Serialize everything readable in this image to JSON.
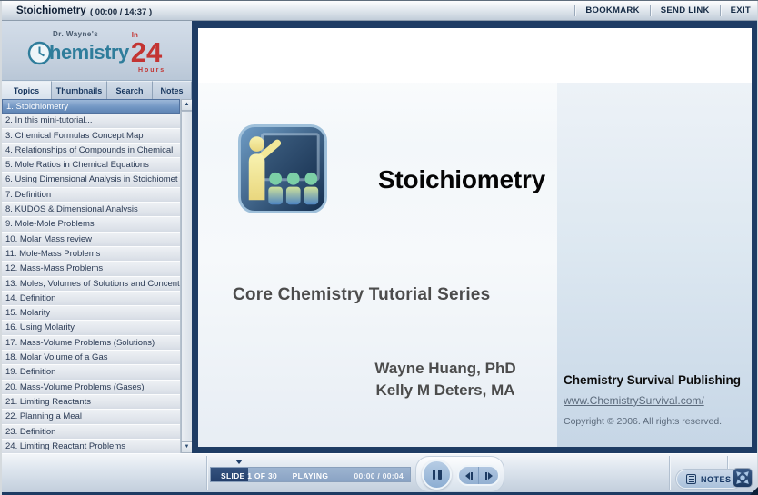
{
  "header": {
    "title": "Stoichiometry",
    "time": "( 00:00 / 14:37 )",
    "menu": [
      "BOOKMARK",
      "SEND LINK",
      "EXIT"
    ]
  },
  "logo": {
    "pre": "Dr. Wayne's",
    "word": "hemistry",
    "in": "In",
    "number": "24",
    "hours": "Hours"
  },
  "sidebar": {
    "tabs": [
      "Topics",
      "Thumbnails",
      "Search",
      "Notes"
    ],
    "active_tab": "Topics",
    "topics": [
      "1. Stoichiometry",
      "2. In this mini-tutorial...",
      "3. Chemical Formulas Concept Map",
      "4. Relationships of Compounds in Chemical",
      "5. Mole Ratios in Chemical Equations",
      "6. Using Dimensional Analysis in Stoichiomet",
      "7. Definition",
      "8. KUDOS & Dimensional Analysis",
      "9. Mole-Mole Problems",
      "10. Molar Mass review",
      "11. Mole-Mass Problems",
      "12. Mass-Mass Problems",
      "13. Moles, Volumes of Solutions and Concent",
      "14. Definition",
      "15. Molarity",
      "16. Using Molarity",
      "17. Mass-Volume Problems (Solutions)",
      "18. Molar Volume of a Gas",
      "19. Definition",
      "20. Mass-Volume Problems (Gases)",
      "21. Limiting Reactants",
      "22. Planning a Meal",
      "23. Definition",
      "24. Limiting Reactant Problems"
    ]
  },
  "slide": {
    "title": "Stoichiometry",
    "subtitle": "Core Chemistry Tutorial Series",
    "authors": [
      "Wayne Huang, PhD",
      "Kelly M Deters, MA"
    ],
    "publisher": {
      "name": "Chemistry Survival Publishing",
      "url": "www.ChemistrySurvival.com/",
      "copyright": "Copyright © 2006. All rights reserved."
    }
  },
  "playbar": {
    "slide_label": "SLIDE 1 OF 30",
    "status": "PLAYING",
    "time": "00:00 / 00:04",
    "notes_label": "NOTES"
  },
  "icons": {
    "scroll_up": "▲",
    "scroll_down": "▼"
  },
  "colors": {
    "frame_navy": "#1e3c64",
    "selected_topic": "#6f94c2",
    "logo_teal": "#2f7d9b",
    "logo_red": "#c33432",
    "progress_fill": "#24406c"
  }
}
